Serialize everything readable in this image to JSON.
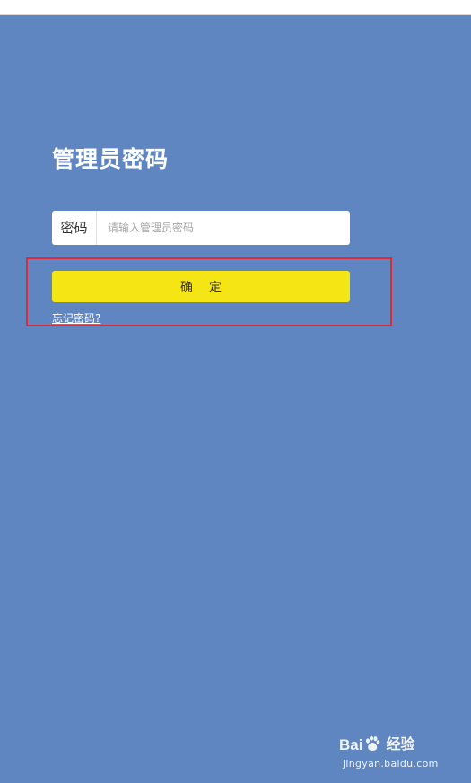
{
  "login": {
    "title": "管理员密码",
    "password_label": "密码",
    "password_placeholder": "请输入管理员密码",
    "password_value": "",
    "confirm_label": "确定",
    "forgot_label": "忘记密码?"
  },
  "watermark": {
    "brand_left": "Bai",
    "brand_right": "经验",
    "url": "jingyan.baidu.com",
    "icon": "baidu-paw-icon"
  },
  "colors": {
    "background": "#6086c2",
    "confirm_button": "#f5e514",
    "highlight_border": "#d92b3a"
  }
}
